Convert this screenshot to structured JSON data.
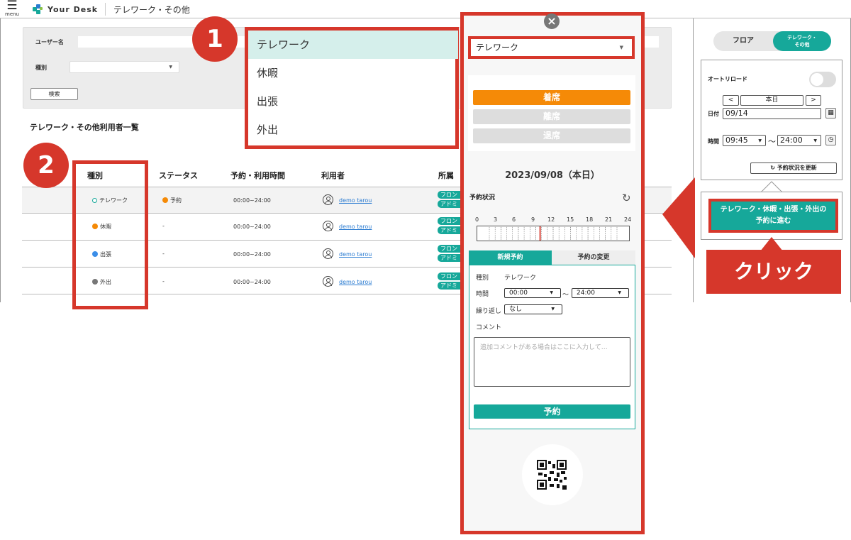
{
  "header": {
    "menu_label": "menu",
    "logo_text": "Your Desk",
    "page_title": "テレワーク・その他"
  },
  "search": {
    "username_label": "ユーザー名",
    "type_label": "種別",
    "search_button": "検索"
  },
  "list": {
    "title": "テレワーク・その他利用者一覧",
    "columns": [
      "種別",
      "ステータス",
      "予約・利用時間",
      "利用者",
      "所属"
    ],
    "rows": [
      {
        "type": "テレワーク",
        "status": "予約",
        "time": "00:00~24:00",
        "user": "demo tarou",
        "tag1": "フロン",
        "tag2": "アドミ"
      },
      {
        "type": "休暇",
        "status": "-",
        "time": "00:00~24:00",
        "user": "demo tarou",
        "tag1": "フロン",
        "tag2": "アドミ"
      },
      {
        "type": "出張",
        "status": "-",
        "time": "00:00~24:00",
        "user": "demo tarou",
        "tag1": "フロン",
        "tag2": "アドミ"
      },
      {
        "type": "外出",
        "status": "-",
        "time": "00:00~24:00",
        "user": "demo tarou",
        "tag1": "フロン",
        "tag2": "アドミ"
      }
    ]
  },
  "callouts": {
    "badge1": "1",
    "badge2": "2",
    "click_label": "クリック"
  },
  "dropdown": {
    "options": [
      "テレワーク",
      "休暇",
      "出張",
      "外出"
    ],
    "selected_index": 0
  },
  "panel": {
    "close_icon": "×",
    "type_value": "テレワーク",
    "status_buttons": [
      "着席",
      "離席",
      "退席"
    ],
    "date": "2023/09/08（本日）",
    "reservation_status_label": "予約状況",
    "timeline_ticks": [
      "0",
      "3",
      "6",
      "9",
      "12",
      "15",
      "18",
      "21",
      "24"
    ],
    "current_hour": 9.75,
    "tabs": [
      "新規予約",
      "予約の変更"
    ],
    "form": {
      "type_label": "種別",
      "type_value": "テレワーク",
      "time_label": "時間",
      "time_start": "00:00",
      "time_sep": "～",
      "time_end": "24:00",
      "repeat_label": "繰り返し",
      "repeat_value": "なし",
      "comment_label": "コメント",
      "comment_placeholder": "追加コメントがある場合はここに入力して…",
      "submit": "予約"
    }
  },
  "sidebar": {
    "toggle_floor": "フロア",
    "toggle_telework_line1": "テレワーク・",
    "toggle_telework_line2": "その他",
    "auto_reload_label": "オートリロード",
    "prev": "<",
    "today": "本日",
    "next": ">",
    "date_label": "日付",
    "date_value": "09/14",
    "time_label": "時間",
    "time_start": "09:45",
    "time_sep": "～",
    "time_end": "24:00",
    "update_button": "予約状況を更新",
    "proceed_line1": "テレワーク・休暇・出張・外出の",
    "proceed_line2": "予約に進む"
  },
  "colors": {
    "accent": "#16a89a",
    "callout_red": "#d6372b",
    "seated_orange": "#f58a07",
    "telework": "#16a89a",
    "vacation": "#f58a07",
    "business_trip": "#3b8ee8",
    "going_out": "#777777"
  }
}
